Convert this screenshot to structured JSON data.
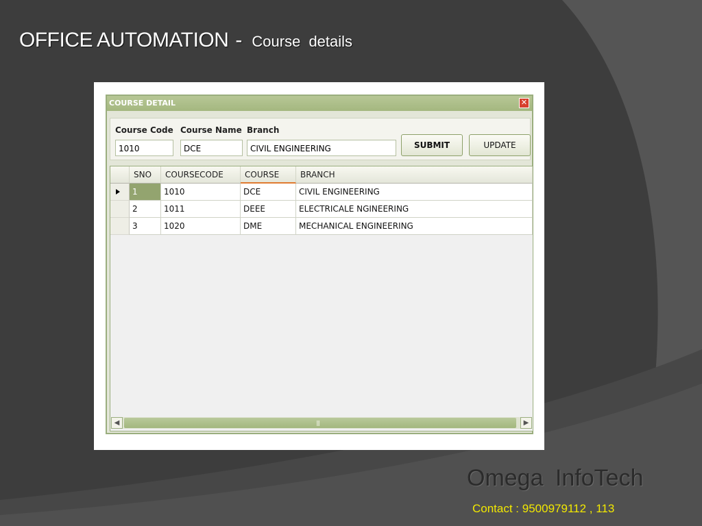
{
  "slide": {
    "title_main": "OFFICE AUTOMATION",
    "title_separator": "-",
    "title_sub": "Course  details",
    "brand": "Omega  InfoTech",
    "contact": "Contact : 9500979112 , 113"
  },
  "window": {
    "title": "COURSE DETAIL",
    "close_glyph": "✕",
    "colors": {
      "titlebar": "#a9bb86",
      "selected_cell": "#93a46f",
      "sort_indicator": "#e07a2f"
    }
  },
  "form": {
    "course_code_label": "Course Code",
    "course_name_label": "Course Name",
    "branch_label": "Branch",
    "course_code_value": "1010",
    "course_name_value": "DCE",
    "branch_value": "CIVIL ENGINEERING",
    "submit_label": "SUBMIT",
    "update_label": "UPDATE"
  },
  "grid": {
    "columns": [
      "SNO",
      "COURSECODE",
      "COURSE",
      "BRANCH"
    ],
    "rows": [
      [
        "1",
        "1010",
        "DCE",
        "CIVIL ENGINEERING"
      ],
      [
        "2",
        "1011",
        "DEEE",
        "ELECTRICALE NGINEERING"
      ],
      [
        "3",
        "1020",
        "DME",
        "MECHANICAL ENGINEERING"
      ]
    ],
    "current_row": 0,
    "sorted_column": 2,
    "scrollbar_grip": "|||"
  }
}
